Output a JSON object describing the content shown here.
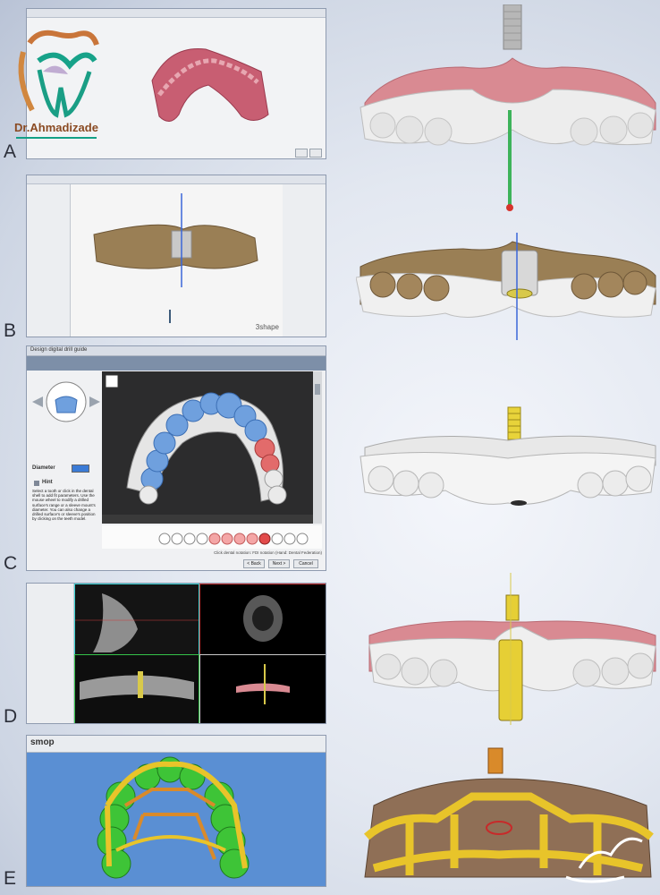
{
  "panels": [
    {
      "letter": "A"
    },
    {
      "letter": "B",
      "brand": "3shape"
    },
    {
      "letter": "C",
      "title": "Design digital drill guide",
      "diameter_label": "Diameter",
      "hint_title": "Hint",
      "hint_text": "Select a tooth or click in the dental shell to add fit parameters. Use the mouse wheel to modify a drilled surface's range or a sleeve mount's diameter. You can also change a drilled surface's or sleeve's position by clicking on the teeth model.",
      "footer_note": "Click dental notation: FDI notation (Hand: Dental Federation)",
      "buttons": {
        "back": "< Back",
        "next": "Next >",
        "cancel": "Cancel"
      }
    },
    {
      "letter": "D"
    },
    {
      "letter": "E",
      "brand": "smop"
    }
  ],
  "logo": {
    "name": "Dr.Ahmadizade"
  },
  "colors": {
    "gum": "#d98a92",
    "teeth": "#eeeeee",
    "green_pin": "#3db35a",
    "blue_axis": "#3a66d8",
    "sleeve": "#d8c94a",
    "smop_bg": "#5a8fd3",
    "guide_yellow": "#e8c42a",
    "teeth_green": "#3ec437",
    "model_blue": "#6fa0de"
  }
}
